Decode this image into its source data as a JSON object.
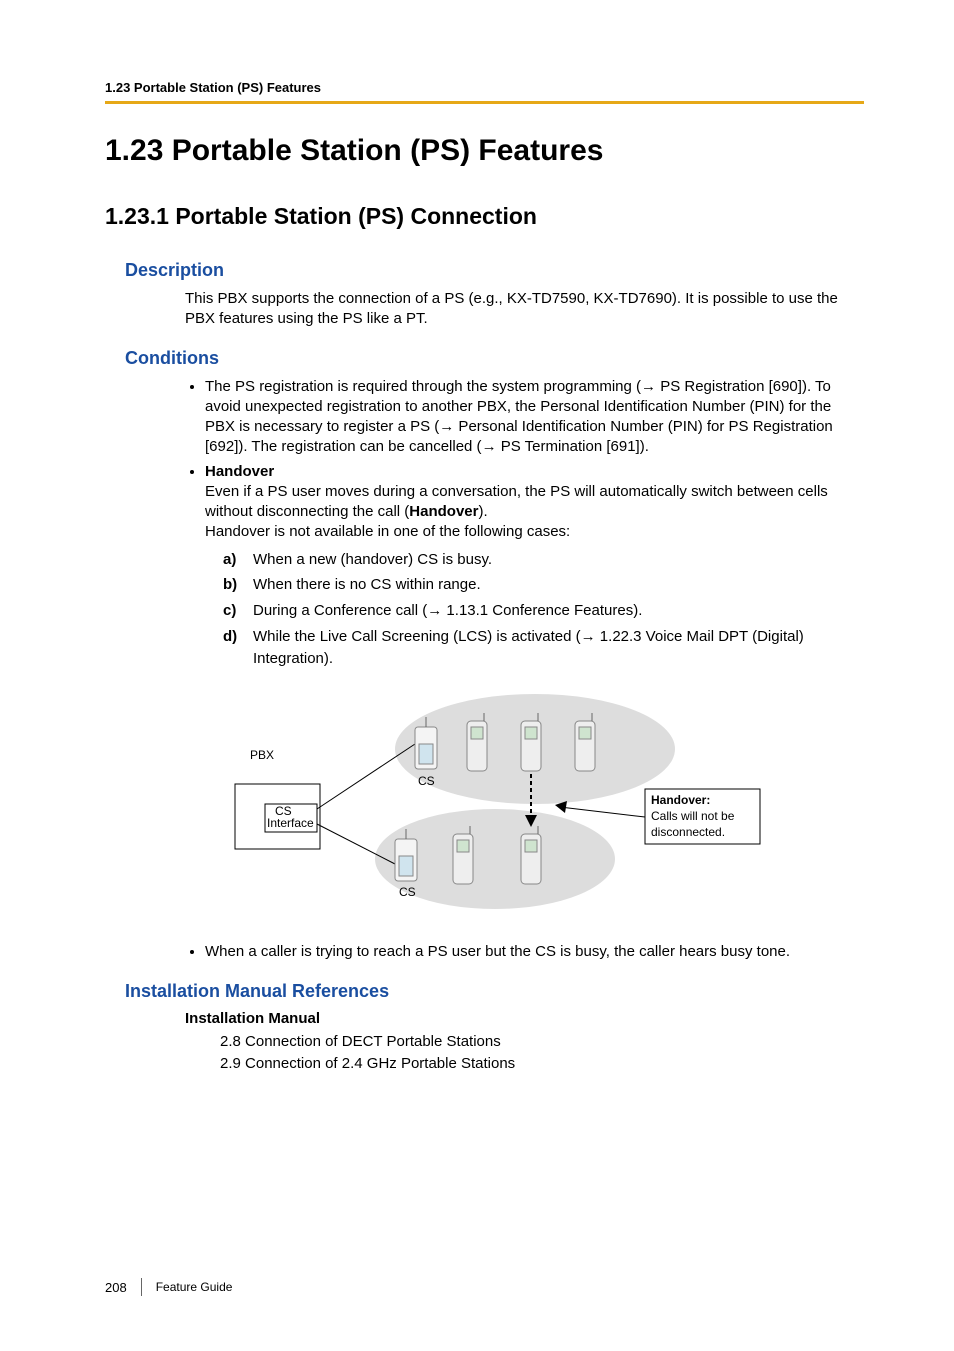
{
  "header": {
    "breadcrumb": "1.23 Portable Station (PS) Features"
  },
  "titles": {
    "main": "1.23   Portable Station (PS) Features",
    "sub": "1.23.1  Portable Station (PS) Connection"
  },
  "description": {
    "heading": "Description",
    "text": "This PBX supports the connection of a PS (e.g., KX-TD7590, KX-TD7690). It is possible to use the PBX features using the PS like a PT."
  },
  "conditions": {
    "heading": "Conditions",
    "bullet1": {
      "p1": "The PS registration is required through the system programming (",
      "a1": " PS Registration [690]). To avoid unexpected registration to another PBX, the Personal Identification Number (PIN) for the PBX is necessary to register a PS (",
      "a2": " Personal Identification Number (PIN) for PS Registration [692]). The registration can be cancelled (",
      "a3": " PS Termination [691])."
    },
    "bullet2": {
      "title": "Handover",
      "line1a": "Even if a PS user moves during a conversation, the PS will automatically switch between cells without disconnecting the call (",
      "line1b": "Handover",
      "line1c": ").",
      "line2": "Handover is not available in one of the following cases:",
      "items": {
        "a": {
          "marker": "a)",
          "text": "When a new (handover) CS is busy."
        },
        "b": {
          "marker": "b)",
          "text": "When there is no CS within range."
        },
        "c": {
          "marker": "c)",
          "t1": "During a Conference call (",
          "t2": " 1.13.1 Conference Features)."
        },
        "d": {
          "marker": "d)",
          "t1": "While the Live Call Screening (LCS) is activated (",
          "t2": " 1.22.3 Voice Mail DPT (Digital) Integration)."
        }
      }
    },
    "bullet3": "When a caller is trying to reach a PS user but the CS is busy, the caller hears busy tone."
  },
  "diagram": {
    "pbx": "PBX",
    "csInterface": "CS\nInterface",
    "csTop": "CS",
    "csBottom": "CS",
    "boxTitle": "Handover:",
    "boxLine1": "Calls will not be",
    "boxLine2": "disconnected."
  },
  "install": {
    "heading": "Installation Manual References",
    "subhead": "Installation Manual",
    "items": [
      "2.8 Connection of DECT Portable Stations",
      "2.9 Connection of 2.4 GHz Portable Stations"
    ]
  },
  "footer": {
    "page": "208",
    "label": "Feature Guide"
  }
}
